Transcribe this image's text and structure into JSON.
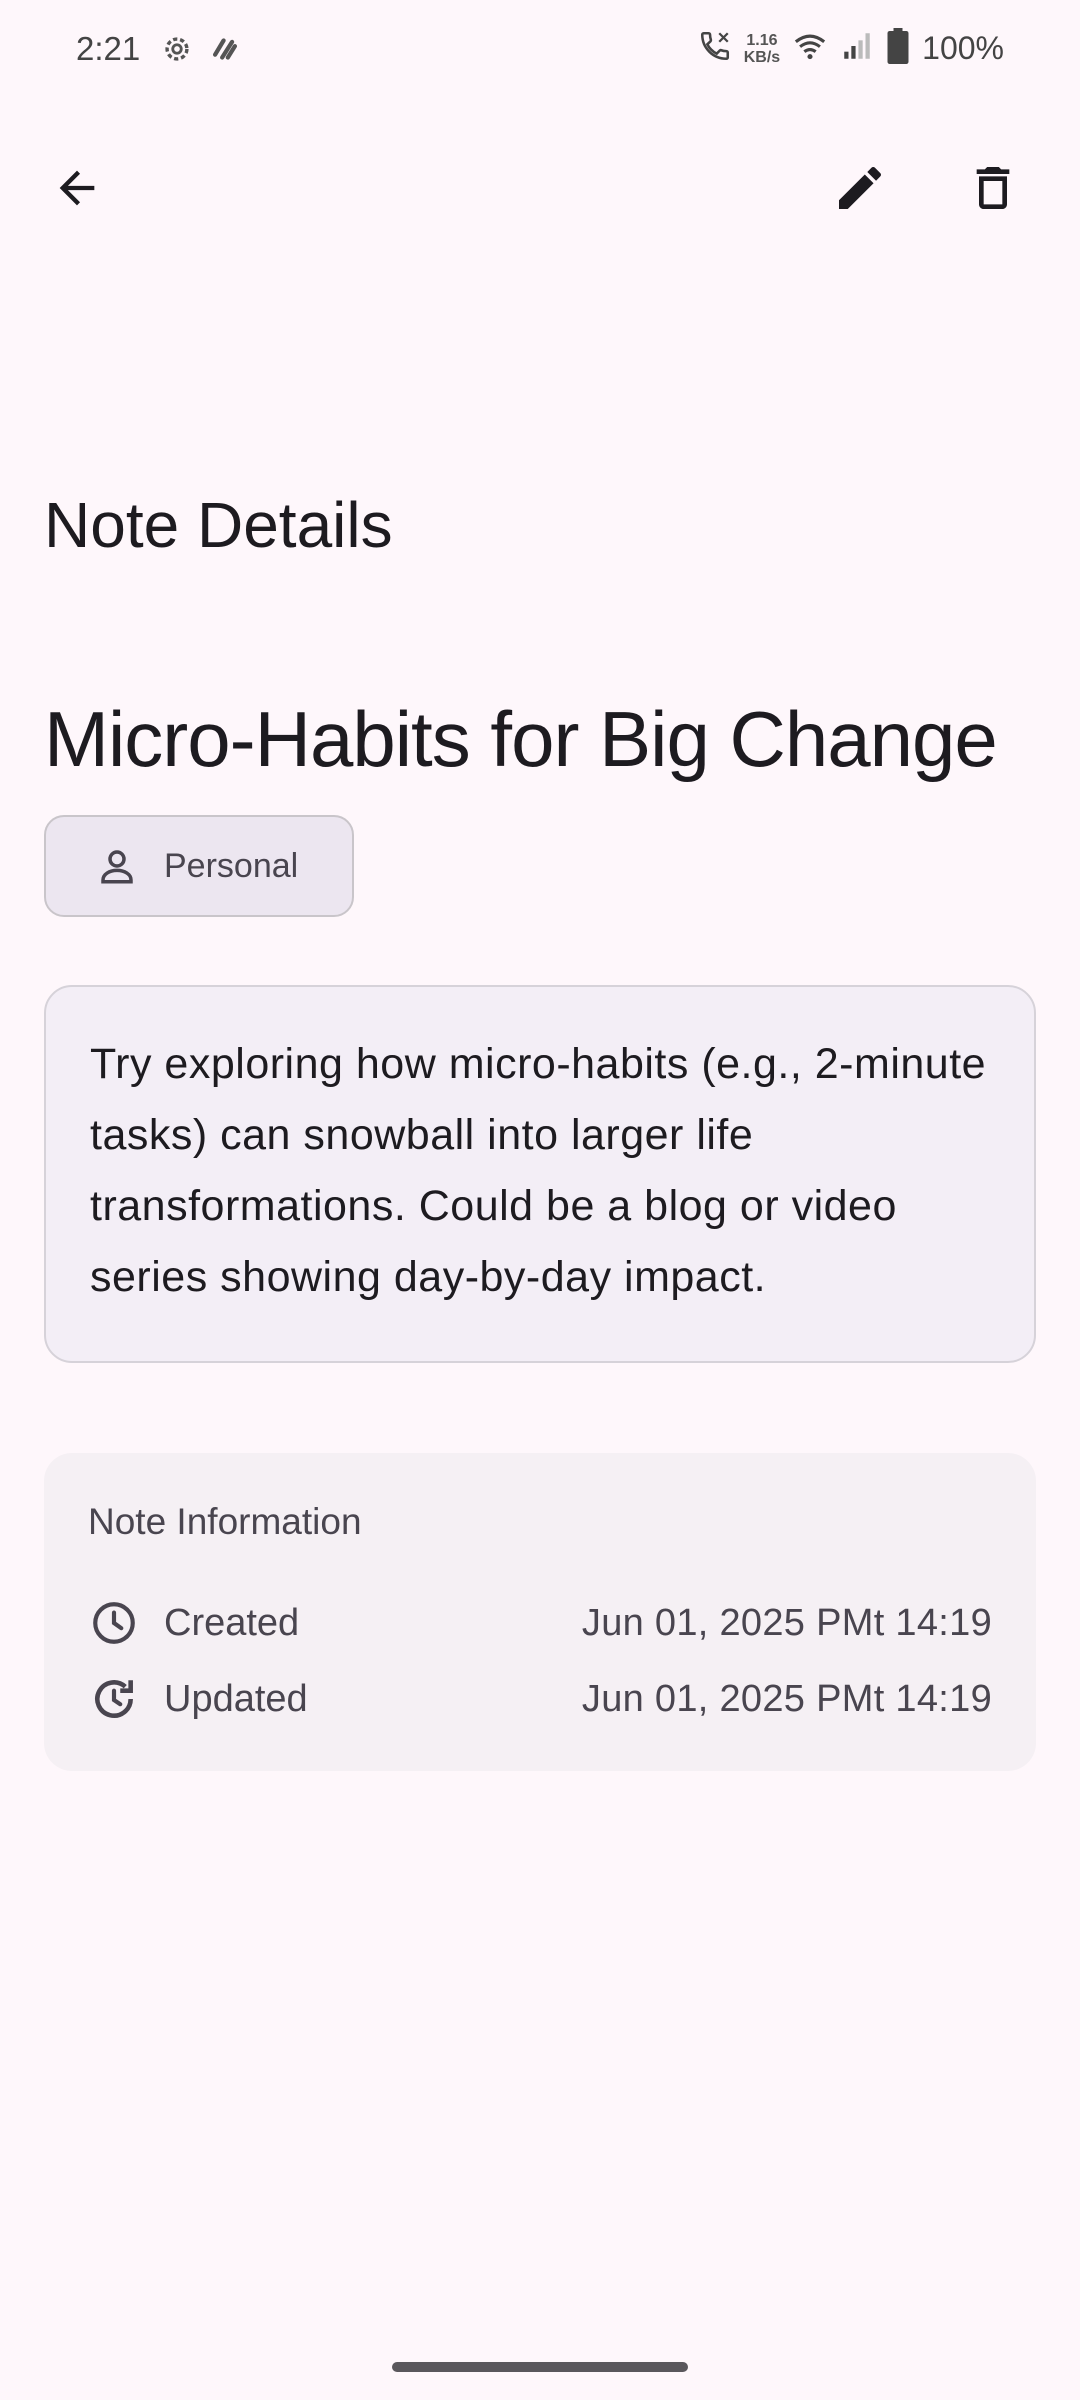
{
  "status_bar": {
    "time": "2:21",
    "net_speed_value": "1.16",
    "net_speed_unit": "KB/s",
    "battery": "100%",
    "icons": [
      "settings-icon",
      "app-notification-icon",
      "call-icon",
      "wifi-icon",
      "signal-icon",
      "battery-icon"
    ]
  },
  "app_bar": {
    "back_icon": "arrow-back-icon",
    "edit_icon": "edit-pencil-icon",
    "delete_icon": "delete-trash-icon"
  },
  "page": {
    "title": "Note Details"
  },
  "note": {
    "title": "Micro-Habits for Big Change",
    "category": "Personal",
    "category_icon": "person-icon",
    "content": "Try exploring how micro-habits (e.g., 2-minute tasks) can snowball into larger life transformations. Could be a blog or video series showing day-by-day impact."
  },
  "info": {
    "title": "Note Information",
    "created_label": "Created",
    "created_value": "Jun 01, 2025 PMt 14:19",
    "updated_label": "Updated",
    "updated_value": "Jun 01, 2025 PMt 14:19"
  },
  "colors": {
    "background": "#FEF7FB",
    "chip_background": "#ECE6F0",
    "content_background": "#F3EEF6",
    "info_background": "#F5F0F4",
    "text_primary": "#1D1B20",
    "text_secondary": "#49454F"
  }
}
